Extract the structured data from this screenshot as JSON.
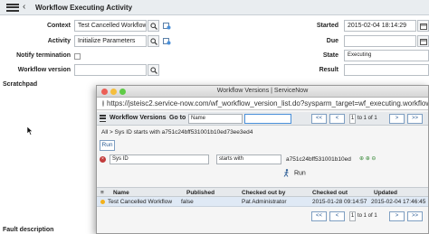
{
  "form": {
    "title": "Workflow Executing Activity",
    "fields": {
      "context_label": "Context",
      "context_value": "Test Cancelled Workflow",
      "activity_label": "Activity",
      "activity_value": "Initialize Parameters",
      "notify_label": "Notify termination",
      "workflow_version_label": "Workflow version",
      "workflow_version_value": "",
      "started_label": "Started",
      "started_value": "2015-02-04 18:14:29",
      "due_label": "Due",
      "due_value": "",
      "state_label": "State",
      "state_value": "Executing",
      "result_label": "Result",
      "result_value": ""
    },
    "sections": {
      "scratchpad": "Scratchpad",
      "fault_description": "Fault description"
    }
  },
  "popup": {
    "window_title": "Workflow Versions | ServiceNow",
    "url": "https://jsteisc2.service-now.com/wf_workflow_version_list.do?sysparm_target=wf_executing.workflow...",
    "list_title": "Workflow Versions",
    "goto_label": "Go to",
    "goto_field": "Name",
    "search_value": "",
    "pagination": {
      "current": "1",
      "of_text": "to 1 of 1"
    },
    "nav": {
      "first": "<<",
      "prev": "<",
      "next": ">",
      "last": ">>"
    },
    "breadcrumb": "All > Sys ID starts with a751c24bff531001b10ed73ee3ed4",
    "run_top": "Run",
    "condition": {
      "field": "Sys ID",
      "operator": "starts with",
      "value": "a751c24bff531001b10ed"
    },
    "run_bottom": "Run",
    "columns": [
      "Name",
      "Published",
      "Checked out by",
      "Checked out",
      "Updated"
    ],
    "rows": [
      {
        "name": "Test Cancelled Workflow",
        "published": "false",
        "checked_out_by": "Pat Administrator",
        "checked_out": "2015-01-28 09:14:57",
        "updated": "2015-02-04 17:46:45"
      }
    ]
  },
  "colors": {
    "header_bg": "#e9edf0",
    "row_highlight": "#dfe9f5",
    "nav_blue": "#2a5b94",
    "focus_blue": "#4a90d9",
    "state_dot": "#f3b11c"
  },
  "icons": [
    "list-menu-icon",
    "back-arrow-icon",
    "search-icon",
    "reference-icon",
    "close-dot-icon",
    "minimize-dot-icon",
    "maximize-dot-icon",
    "lock-icon",
    "remove-condition-icon",
    "run-person-icon",
    "state-dot-icon",
    "calendar-icon",
    "pointer-cursor-icon"
  ]
}
